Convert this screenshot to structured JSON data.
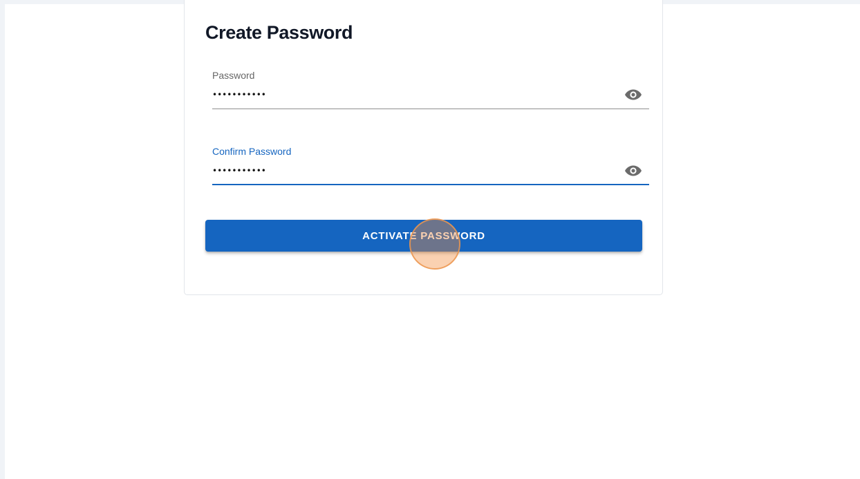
{
  "form": {
    "title": "Create Password",
    "password": {
      "label": "Password",
      "value": "•••••••••••",
      "toggle_icon": "eye-icon"
    },
    "confirm_password": {
      "label": "Confirm Password",
      "value": "•••••••••••",
      "toggle_icon": "eye-icon"
    },
    "submit_label": "ACTIVATE PASSWORD"
  },
  "colors": {
    "primary": "#1565c0",
    "title": "#111827",
    "label": "#666666",
    "click_indicator": "#f28c3c"
  }
}
